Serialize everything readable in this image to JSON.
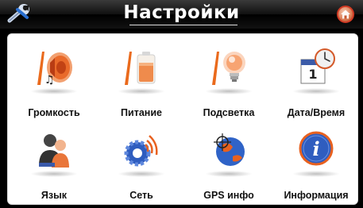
{
  "header": {
    "title": "Настройки",
    "left_icon": "wrench-icon",
    "right_icon": "home-icon"
  },
  "items": [
    {
      "label": "Громкость",
      "icon": "speaker-icon"
    },
    {
      "label": "Питание",
      "icon": "battery-icon"
    },
    {
      "label": "Подсветка",
      "icon": "lightbulb-icon"
    },
    {
      "label": "Дата/Время",
      "icon": "calendar-clock-icon"
    },
    {
      "label": "Язык",
      "icon": "users-icon"
    },
    {
      "label": "Сеть",
      "icon": "network-gear-icon"
    },
    {
      "label": "GPS инфо",
      "icon": "globe-crosshair-icon"
    },
    {
      "label": "Информация",
      "icon": "info-icon"
    }
  ],
  "colors": {
    "accent": "#e8611f",
    "panel": "#ffffff",
    "bar": "#000000"
  }
}
